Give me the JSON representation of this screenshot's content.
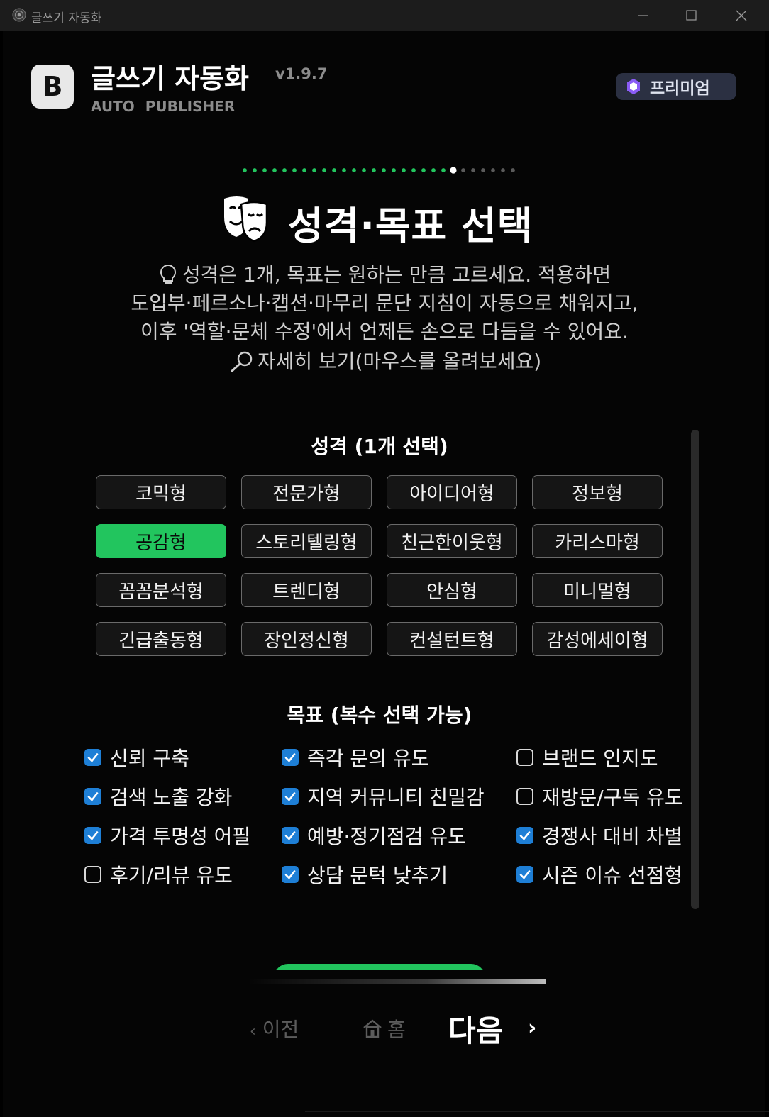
{
  "window": {
    "title": "글쓰기 자동화",
    "controls": [
      "minimize-icon",
      "maximize-icon",
      "close-icon"
    ]
  },
  "header": {
    "logo_letter": "B",
    "app_name": "글쓰기 자동화",
    "version": "v1.9.7",
    "subtitle": "AUTO  PUBLISHER",
    "premium_label": "프리미엄",
    "premium_icon": "gem-icon"
  },
  "progress_steps": {
    "total": 28,
    "completed": 21,
    "current": 22,
    "colors": {
      "done": "#22c55e",
      "current": "#ffffff",
      "todo": "#5a5a5a"
    }
  },
  "page": {
    "title": "성격·목표 선택",
    "title_icon": "theater-masks-icon",
    "description_lines": [
      "성격은 1개, 목표는 원하는 만큼 고르세요. 적용하면",
      "도입부·페르소나·캡션·마무리 문단 지침이 자동으로 채워지고,",
      "이후 '역할·문체 수정'에서 언제든 손으로 다듬을 수 있어요."
    ],
    "detail_link": "자세히 보기(마우스를 올려보세요)"
  },
  "personality": {
    "title": "성격 (1개 선택)",
    "selected": "공감형",
    "options": [
      "코믹형",
      "전문가형",
      "아이디어형",
      "정보형",
      "공감형",
      "스토리텔링형",
      "친근한이웃형",
      "카리스마형",
      "꼼꼼분석형",
      "트렌디형",
      "안심형",
      "미니멀형",
      "긴급출동형",
      "장인정신형",
      "컨설턴트형",
      "감성에세이형"
    ]
  },
  "goals": {
    "title": "목표 (복수 선택 가능)",
    "items": [
      {
        "label": "신뢰 구축",
        "checked": true
      },
      {
        "label": "즉각 문의 유도",
        "checked": true
      },
      {
        "label": "브랜드 인지도",
        "checked": false
      },
      {
        "label": "검색 노출 강화",
        "checked": true
      },
      {
        "label": "지역 커뮤니티 친밀감",
        "checked": true
      },
      {
        "label": "재방문/구독 유도",
        "checked": false
      },
      {
        "label": "가격 투명성 어필",
        "checked": true
      },
      {
        "label": "예방·정기점검 유도",
        "checked": true
      },
      {
        "label": "경쟁사 대비 차별",
        "checked": true
      },
      {
        "label": "후기/리뷰 유도",
        "checked": false
      },
      {
        "label": "상담 문턱 낮추기",
        "checked": true
      },
      {
        "label": "시즌 이슈 선점형",
        "checked": true
      }
    ]
  },
  "footer": {
    "prev_label": "이전",
    "prev_chevron": "‹",
    "home_label": "홈",
    "next_label": "다음",
    "next_chevron": "›"
  },
  "colors": {
    "accent": "#22c55e",
    "checkbox": "#1e7fd6",
    "premium_bg": "#2b3042",
    "gem": "#8b5cf6"
  }
}
